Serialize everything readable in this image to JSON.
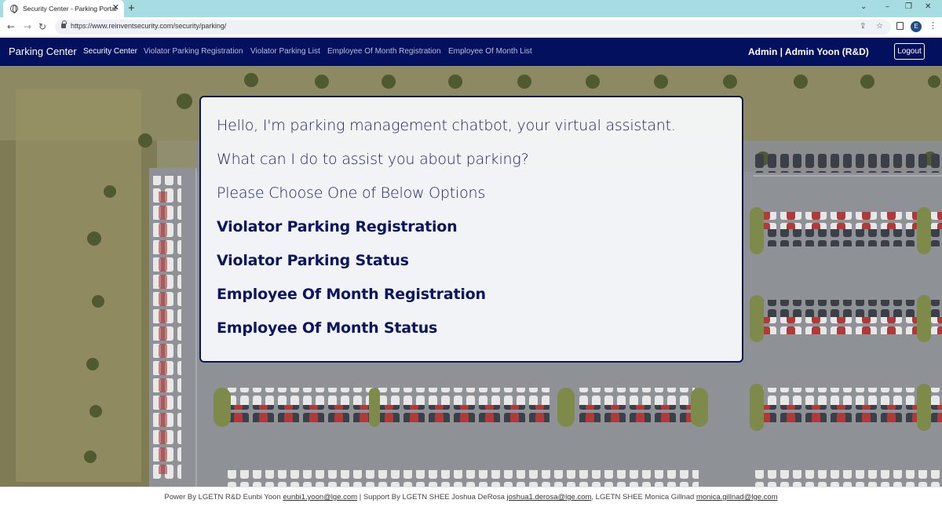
{
  "browser": {
    "tab_title": "Security Center - Parking Portal",
    "url": "https://www.reinventsecurity.com/security/parking/",
    "profile_initial": "E"
  },
  "navbar": {
    "brand": "Parking Center",
    "links": [
      {
        "label": "Security Center",
        "active": true
      },
      {
        "label": "Violator Parking Registration",
        "active": false
      },
      {
        "label": "Violator Parking List",
        "active": false
      },
      {
        "label": "Employee Of Month Registration",
        "active": false
      },
      {
        "label": "Employee Of Month List",
        "active": false
      }
    ],
    "user": "Admin | Admin Yoon (R&D)",
    "logout_label": "Logout"
  },
  "chat": {
    "greeting": "Hello, I'm parking management chatbot, your virtual assistant.",
    "question": "What can I do to assist you about parking?",
    "instruction": "Please Choose One of Below Options",
    "options": [
      "Violator Parking Registration",
      "Violator Parking Status",
      "Employee Of Month Registration",
      "Employee Of Month Status"
    ]
  },
  "footer": {
    "text1": "Power By LGETN R&D Eunbi Yoon ",
    "email1": "eunbi1.yoon@lge.com",
    "text2": " | Support By LGETN SHEE Joshua DeRosa ",
    "email2": "joshua1.derosa@lge.com",
    "text3": ", LGETN SHEE Monica Gillnad ",
    "email3": "monica.gillnad@lge.com"
  },
  "colors": {
    "navbar": "#03105e",
    "accent_text": "#0b1560",
    "tabbar": "#a7dce3"
  }
}
